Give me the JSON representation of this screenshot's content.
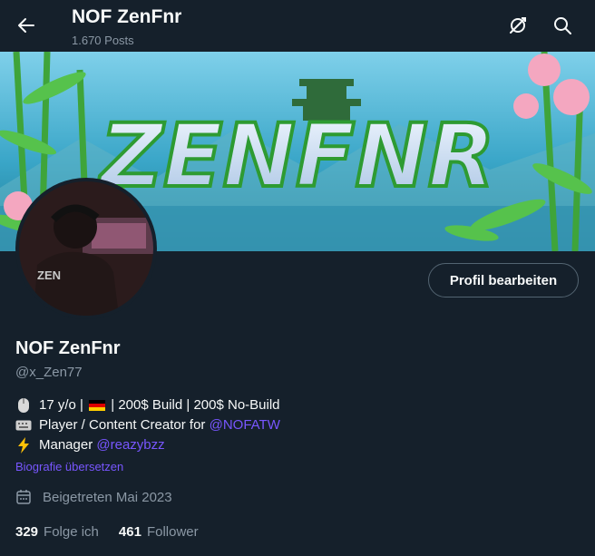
{
  "header": {
    "title": "NOF ZenFnr",
    "posts": "1.670 Posts",
    "icons": {
      "back": "arrow-left-icon",
      "sync": "sync-off-icon",
      "search": "search-icon"
    }
  },
  "banner": {
    "text": "ZENFNR"
  },
  "avatar": {
    "jersey_text": "ZEN"
  },
  "profile": {
    "edit_button": "Profil bearbeiten",
    "name": "NOF ZenFnr",
    "handle": "@x_Zen77",
    "bio": {
      "line1": "17 y/o | ",
      "line1_rest": " | 200$ Build | 200$ No-Build",
      "line2": "Player / Content Creator for ",
      "line2_link": "@NOFATW",
      "line3": "Manager ",
      "line3_link": "@reazybzz"
    },
    "translate": "Biografie übersetzen",
    "joined": "Beigetreten Mai 2023",
    "following_count": "329",
    "following_label": "Folge ich",
    "followers_count": "461",
    "followers_label": "Follower"
  },
  "colors": {
    "background": "#15202b",
    "accent": "#7856ff",
    "muted": "#8b98a5"
  }
}
